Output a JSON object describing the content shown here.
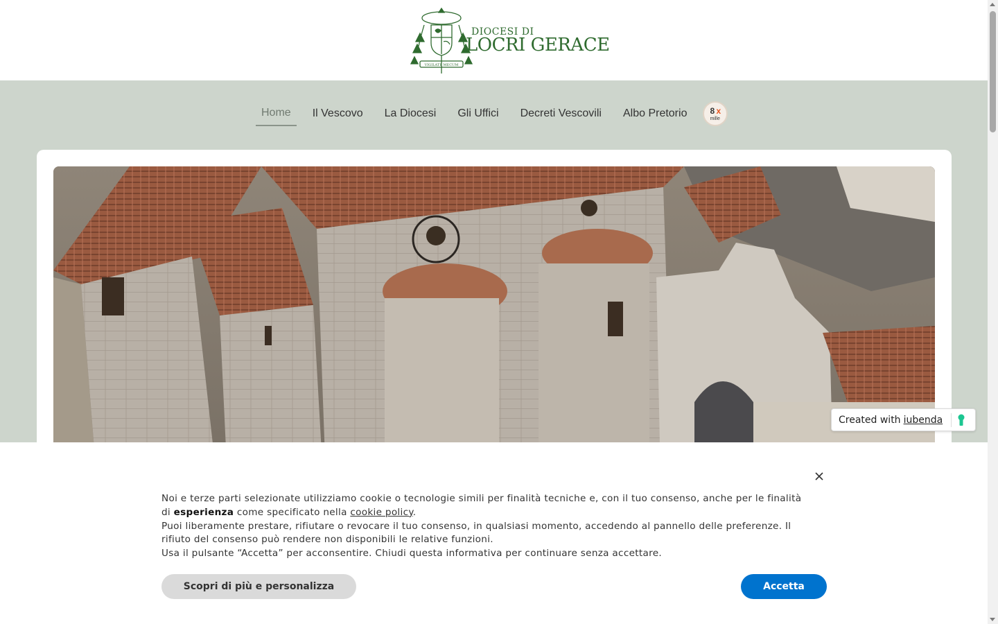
{
  "header": {
    "logo_small": "DIOCESI DI",
    "logo_big": "LOCRI GERACE",
    "logo_motto": "VIGILATE MECUM"
  },
  "nav": {
    "items": [
      {
        "label": "Home",
        "active": true
      },
      {
        "label": "Il Vescovo"
      },
      {
        "label": "La Diocesi"
      },
      {
        "label": "Gli Uffici"
      },
      {
        "label": "Decreti Vescovili"
      },
      {
        "label": "Albo Pretorio"
      }
    ],
    "badge_num": "8",
    "badge_x": "x",
    "badge_sub": "mille"
  },
  "iubenda_badge": {
    "prefix": "Created with",
    "link": "iubenda"
  },
  "cookie": {
    "line1_a": "Noi e terze parti selezionate utilizziamo cookie o tecnologie simili per finalità tecniche e, con il tuo consenso, anche per le finalità di ",
    "line1_bold": "esperienza",
    "line1_b": " come specificato nella ",
    "line1_link": "cookie policy",
    "line1_end": ".",
    "line2": "Puoi liberamente prestare, rifiutare o revocare il tuo consenso, in qualsiasi momento, accedendo al pannello delle preferenze. Il rifiuto del consenso può rendere non disponibili le relative funzioni.",
    "line3": "Usa il pulsante “Accetta” per acconsentire. Chiudi questa informativa per continuare senza accettare.",
    "more_label": "Scopri di più e personalizza",
    "accept_label": "Accetta"
  },
  "colors": {
    "brand_green": "#2f6b2f",
    "nav_bg": "#cdd5cc",
    "accept_blue": "#0073ce"
  }
}
